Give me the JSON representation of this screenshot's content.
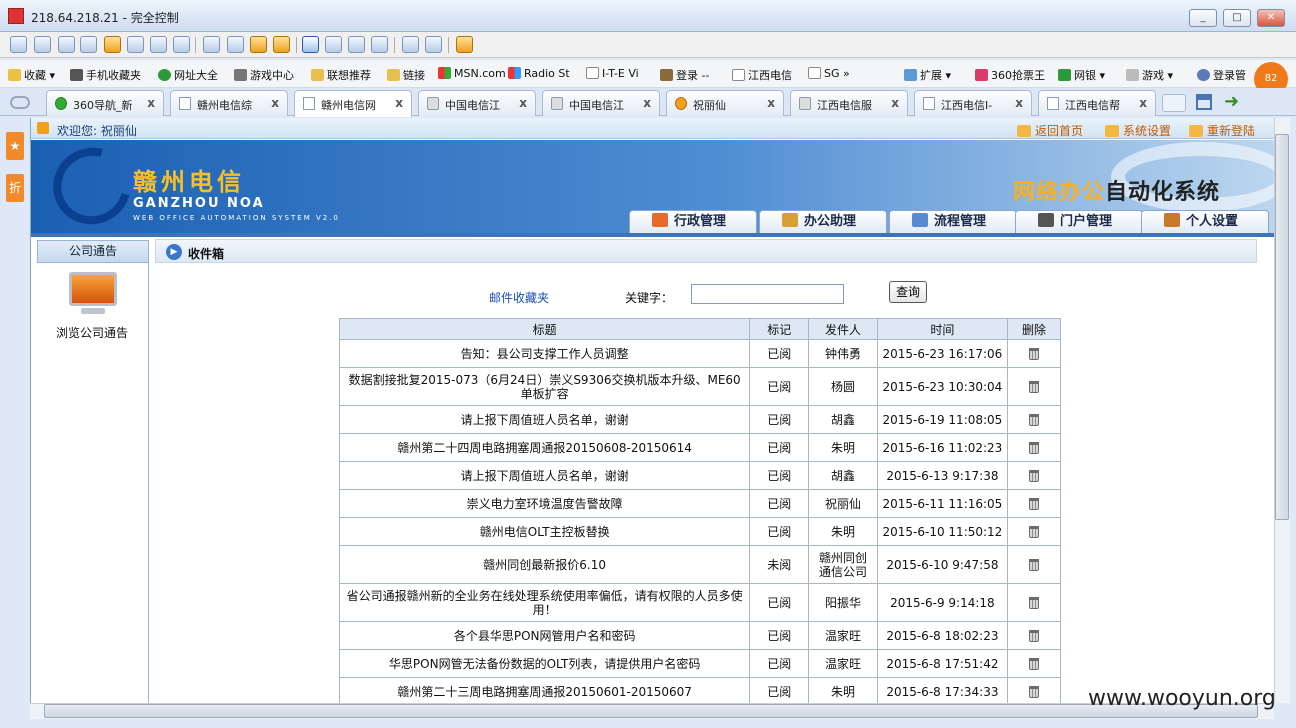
{
  "window": {
    "title": "218.64.218.21 - 完全控制"
  },
  "bookmarks": [
    {
      "label": "收藏"
    },
    {
      "label": "手机收藏夹"
    },
    {
      "label": "网址大全"
    },
    {
      "label": "游戏中心"
    },
    {
      "label": "联想推荐"
    },
    {
      "label": "链接"
    },
    {
      "label": "MSN.com"
    },
    {
      "label": "Radio St"
    },
    {
      "label": "I-T-E Vi"
    },
    {
      "label": "登录 --"
    },
    {
      "label": "江西电信"
    },
    {
      "label": "SG"
    },
    {
      "label": "扩展"
    },
    {
      "label": "360抢票王"
    },
    {
      "label": "网银"
    },
    {
      "label": "游戏"
    },
    {
      "label": "登录管"
    }
  ],
  "badge_text": "82",
  "tabs": [
    {
      "label": "360导航_新"
    },
    {
      "label": "赣州电信综"
    },
    {
      "label": "赣州电信网"
    },
    {
      "label": "中国电信江"
    },
    {
      "label": "中国电信江"
    },
    {
      "label": "祝丽仙"
    },
    {
      "label": "江西电信服"
    },
    {
      "label": "江西电信I-"
    },
    {
      "label": "江西电信帮"
    }
  ],
  "edge_text": "折",
  "welcome": {
    "text": "欢迎您: 祝丽仙",
    "links": [
      "返回首页",
      "系统设置",
      "重新登陆"
    ]
  },
  "banner": {
    "brand": "赣州电信",
    "sub": "GANZHOU NOA",
    "sub2": "WEB OFFICE AUTOMATION SYSTEM V2.0",
    "system_highlight": "网络办公",
    "system_rest": "自动化系统"
  },
  "nav": [
    "行政管理",
    "办公助理",
    "流程管理",
    "门户管理",
    "个人设置"
  ],
  "left_panel": {
    "header": "公司通告",
    "item": "浏览公司通告"
  },
  "inbox": {
    "title": "收件箱",
    "fav_link": "邮件收藏夹",
    "keyword_label": "关键字：",
    "keyword_value": "",
    "query_button": "查询",
    "columns": [
      "标题",
      "标记",
      "发件人",
      "时间",
      "删除"
    ],
    "rows": [
      {
        "subject": "告知：县公司支撑工作人员调整",
        "mark": "已阅",
        "sender": "钟伟勇",
        "time": "2015-6-23 16:17:06"
      },
      {
        "subject": "数据割接批复2015-073（6月24日）崇义S9306交换机版本升级、ME60单板扩容",
        "mark": "已阅",
        "sender": "杨圆",
        "time": "2015-6-23 10:30:04"
      },
      {
        "subject": "请上报下周值班人员名单，谢谢",
        "mark": "已阅",
        "sender": "胡鑫",
        "time": "2015-6-19 11:08:05"
      },
      {
        "subject": "赣州第二十四周电路拥塞周通报20150608-20150614",
        "mark": "已阅",
        "sender": "朱明",
        "time": "2015-6-16 11:02:23"
      },
      {
        "subject": "请上报下周值班人员名单，谢谢",
        "mark": "已阅",
        "sender": "胡鑫",
        "time": "2015-6-13 9:17:38"
      },
      {
        "subject": "崇义电力室环境温度告警故障",
        "mark": "已阅",
        "sender": "祝丽仙",
        "time": "2015-6-11 11:16:05"
      },
      {
        "subject": "赣州电信OLT主控板替换",
        "mark": "已阅",
        "sender": "朱明",
        "time": "2015-6-10 11:50:12"
      },
      {
        "subject": "赣州同创最新报价6.10",
        "mark": "未阅",
        "sender": "赣州同创通信公司",
        "time": "2015-6-10 9:47:58"
      },
      {
        "subject": "省公司通报赣州新的全业务在线处理系统使用率偏低，请有权限的人员多使用！",
        "mark": "已阅",
        "sender": "阳振华",
        "time": "2015-6-9 9:14:18"
      },
      {
        "subject": "各个县华思PON网管用户名和密码",
        "mark": "已阅",
        "sender": "温家旺",
        "time": "2015-6-8 18:02:23"
      },
      {
        "subject": "华思PON网管无法备份数据的OLT列表，请提供用户名密码",
        "mark": "已阅",
        "sender": "温家旺",
        "time": "2015-6-8 17:51:42"
      },
      {
        "subject": "赣州第二十三周电路拥塞周通报20150601-20150607",
        "mark": "已阅",
        "sender": "朱明",
        "time": "2015-6-8 17:34:33"
      }
    ]
  },
  "watermark": "www.wooyun.org"
}
